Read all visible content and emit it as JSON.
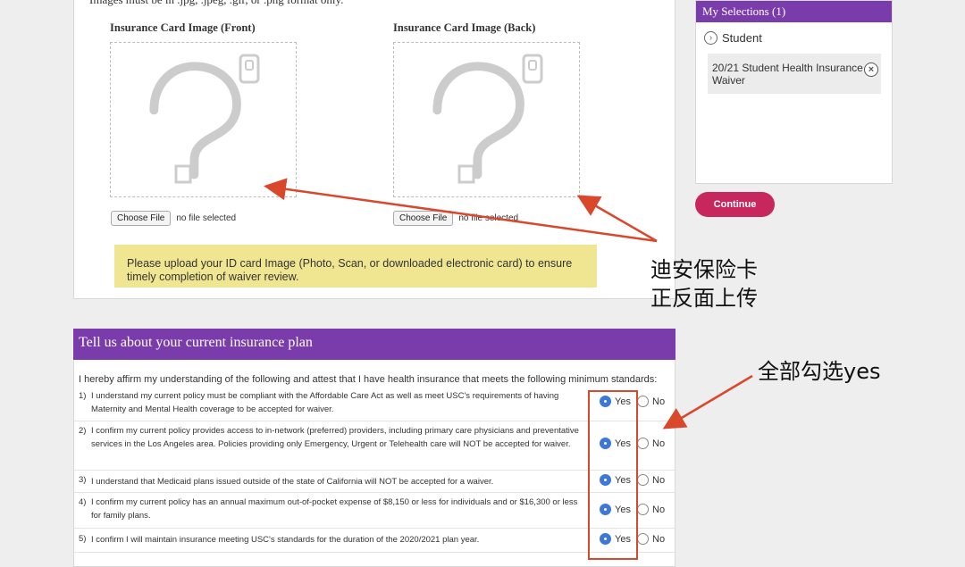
{
  "upload": {
    "cut_text": "Images must be in .jpg, .jpeg, .gif, or .png format only.",
    "front_title": "Insurance Card Image (Front)",
    "back_title": "Insurance Card Image (Back)",
    "choose_file_label": "Choose File",
    "no_file_label": "no file selected",
    "notice": "Please upload your ID card Image (Photo, Scan, or downloaded electronic card) to ensure timely completion of waiver review."
  },
  "sidebar": {
    "header": "My Selections (1)",
    "student_label": "Student",
    "selection_item": "20/21 Student Health Insurance Waiver",
    "continue_label": "Continue"
  },
  "plan": {
    "header": "Tell us about your current insurance plan",
    "affirm": "I hereby affirm my understanding of the following and attest that I have health insurance that meets the following minimum standards:",
    "yes_label": "Yes",
    "no_label": "No",
    "questions": [
      {
        "num": "1)",
        "text": "I understand my current policy must be compliant with the Affordable Care Act as well as meet USC's requirements of having Maternity and Mental Health coverage to be accepted for waiver.",
        "selected": "Yes"
      },
      {
        "num": "2)",
        "text": "I confirm my current policy provides access to in-network (preferred) providers, including primary care physicians and preventative services in the Los Angeles area. Policies providing only Emergency, Urgent or Telehealth care will NOT be accepted for waiver.",
        "selected": "Yes"
      },
      {
        "num": "3)",
        "text": "I understand that Medicaid plans issued outside of the state of California will NOT be accepted for a waiver.",
        "selected": "Yes"
      },
      {
        "num": "4)",
        "text": "I confirm my current policy has an annual maximum out-of-pocket expense of $8,150 or less for individuals and or $16,300 or less for family plans.",
        "selected": "Yes"
      },
      {
        "num": "5)",
        "text": "I confirm I will maintain insurance meeting USC's standards for the duration of the 2020/2021 plan year.",
        "selected": "Yes"
      }
    ]
  },
  "annotations": {
    "upload_note_line1": "迪安保险卡",
    "upload_note_line2": "正反面上传",
    "select_yes_note": "全部勾选yes",
    "arrow_color": "#d9482b"
  },
  "colors": {
    "purple": "#7a3cab",
    "continue": "#c8275e",
    "notice_bg": "#f0e691",
    "radio_selected": "#3d78d8"
  }
}
